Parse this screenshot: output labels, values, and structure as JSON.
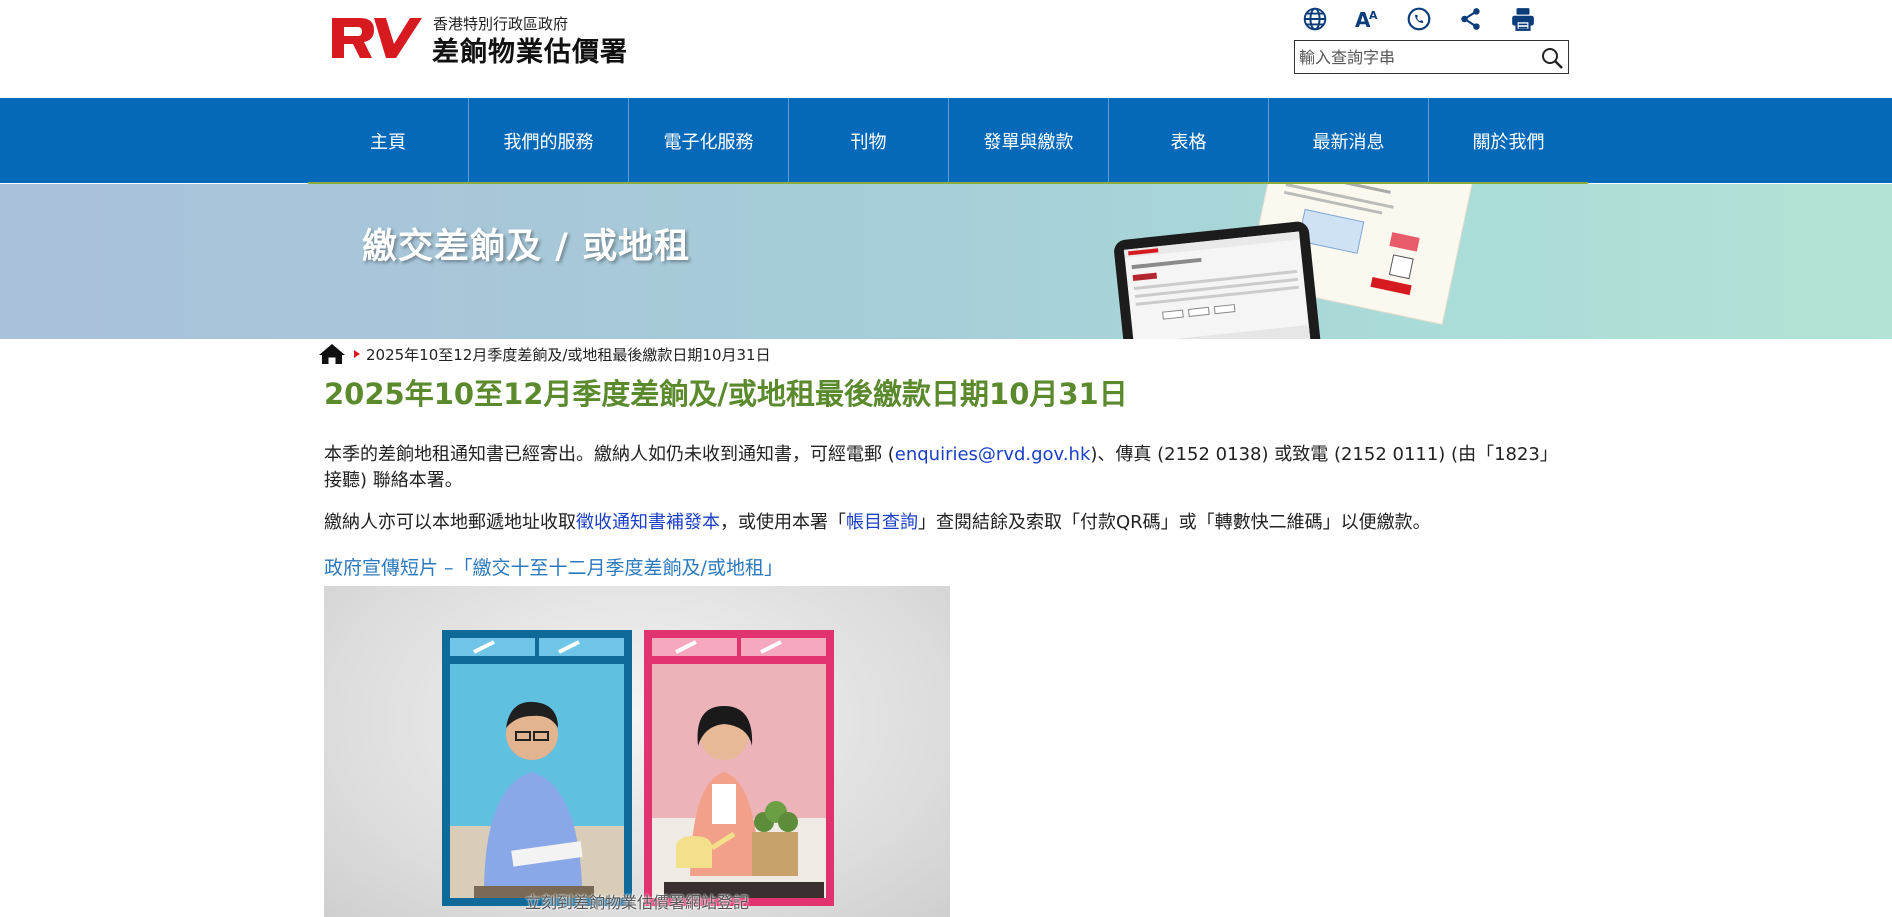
{
  "header": {
    "dept_subtitle": "香港特別行政區政府",
    "dept_name": "差餉物業估價署",
    "tools": [
      {
        "icon": "globe-icon"
      },
      {
        "icon": "font-size-icon",
        "label": "AA"
      },
      {
        "icon": "phone-icon"
      },
      {
        "icon": "share-icon"
      },
      {
        "icon": "print-icon"
      }
    ],
    "search_placeholder": "輸入查詢字串"
  },
  "nav": {
    "items": [
      "主頁",
      "我們的服務",
      "電子化服務",
      "刊物",
      "發單與繳款",
      "表格",
      "最新消息",
      "關於我們"
    ]
  },
  "banner": {
    "title": "繳交差餉及 / 或地租"
  },
  "breadcrumb": {
    "current": "2025年10至12月季度差餉及/或地租最後繳款日期10月31日"
  },
  "article": {
    "title": "2025年10至12月季度差餉及/或地租最後繳款日期10月31日",
    "para1": {
      "before": "本季的差餉地租通知書已經寄出。繳納人如仍未收到通知書，可經電郵 (",
      "email": "enquiries@rvd.gov.hk",
      "after": ")、傳真 (2152 0138) 或致電 (2152 0111) (由「1823」接聽) 聯絡本署。"
    },
    "para2": {
      "before": "繳納人亦可以本地郵遞地址收取",
      "link1": "徵收通知書補發本",
      "middle": "，或使用本署「",
      "link2": "帳目查詢",
      "after": "」查閱結餘及索取「付款QR碼」或「轉數快二維碼」以便繳款。"
    },
    "video_title": "政府宣傳短片 –「繳交十至十二月季度差餉及/或地租」",
    "video_caption": "立刻到差餉物業估價署網站登記"
  },
  "colors": {
    "nav_bg": "#0469b8",
    "title_green": "#5b8a2d",
    "link_blue": "#1a3fc7",
    "video_title_blue": "#2b79bf",
    "logo_red": "#d71920"
  }
}
